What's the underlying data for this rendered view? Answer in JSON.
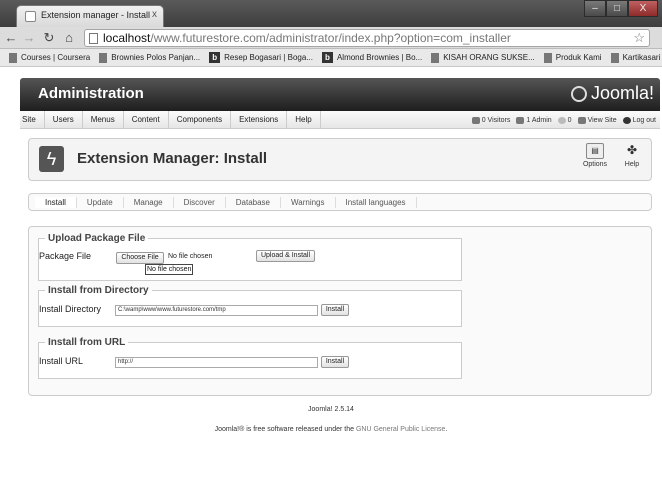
{
  "browser": {
    "tab_title": "Extension manager - Install",
    "tab_close": "x",
    "window_buttons": {
      "minimize": "–",
      "maximize": "□",
      "close": "X"
    },
    "url_host": "localhost",
    "url_rest": "/www.futurestore.com/administrator/index.php?option=com_installer",
    "bookmarks": [
      {
        "label": "Courses | Coursera",
        "icon": "page-icon"
      },
      {
        "label": "Brownies Polos Panjan...",
        "icon": "page-icon"
      },
      {
        "label": "Resep Bogasari | Boga...",
        "icon": "b-icon"
      },
      {
        "label": "Almond Brownies | Bo...",
        "icon": "b-icon"
      },
      {
        "label": "KISAH ORANG SUKSE...",
        "icon": "page-icon"
      },
      {
        "label": "Produk Kami",
        "icon": "page-icon"
      },
      {
        "label": "Kartikasari Store",
        "icon": "page-icon"
      }
    ]
  },
  "admin": {
    "title": "Administration",
    "logo_text": "Joomla!",
    "menu": [
      "Site",
      "Users",
      "Menus",
      "Content",
      "Components",
      "Extensions",
      "Help"
    ],
    "status": {
      "visitors": "0 Visitors",
      "admins": "1 Admin",
      "messages": "0",
      "view_site": "View Site",
      "logout": "Log out"
    }
  },
  "header": {
    "title": "Extension Manager: Install",
    "options_label": "Options",
    "help_label": "Help"
  },
  "tabs": [
    "Install",
    "Update",
    "Manage",
    "Discover",
    "Database",
    "Warnings",
    "Install languages"
  ],
  "upload": {
    "legend": "Upload Package File",
    "label": "Package File",
    "choose_button": "Choose File",
    "no_file": "No file chosen",
    "tooltip": "No file chosen",
    "submit": "Upload & Install"
  },
  "directory": {
    "legend": "Install from Directory",
    "label": "Install Directory",
    "value": "C:\\wamp\\www\\www.futurestore.com/tmp",
    "submit": "Install"
  },
  "url_install": {
    "legend": "Install from URL",
    "label": "Install URL",
    "value": "http://",
    "submit": "Install"
  },
  "footer": {
    "version": "Joomla! 2.5.14",
    "license_prefix": "Joomla!® is free software released under the ",
    "license_link": "GNU General Public License",
    "license_suffix": "."
  }
}
